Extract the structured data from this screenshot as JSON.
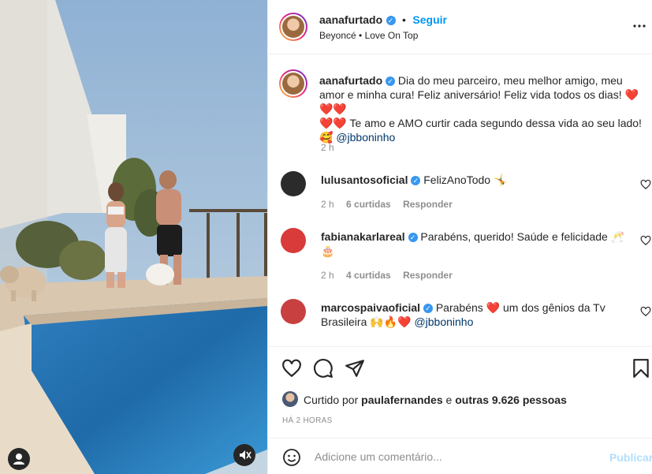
{
  "post": {
    "username": "aanafurtado",
    "follow_separator": "•",
    "follow_label": "Seguir",
    "audio": "Beyoncé • Love On Top",
    "caption_part1": "Dia do meu parceiro, meu melhor amigo, meu amor e minha cura! Feliz aniversário! Feliz vida todos os dias! ",
    "caption_hearts1": "❤️❤️❤️",
    "caption_hearts2": "❤️❤️",
    "caption_part2": " Te amo e AMO curtir cada segundo dessa vida ao seu lado!",
    "caption_emoji": "🥰",
    "caption_mention": "@jbboninho",
    "caption_time": "2 h"
  },
  "comments": [
    {
      "username": "lulusantosoficial",
      "text": "FelizAnoTodo",
      "emoji": "🤸",
      "time": "2 h",
      "likes": "6 curtidas",
      "reply": "Responder",
      "avatar_color": "#2b2b2b"
    },
    {
      "username": "fabianakarlareal",
      "text": "Parabéns, querido! Saúde e felicidade",
      "emoji": "🥂",
      "emoji2": "🎂",
      "time": "2 h",
      "likes": "4 curtidas",
      "reply": "Responder",
      "avatar_color": "#d93a3a"
    },
    {
      "username": "marcospaivaoficial",
      "text_part1": "Parabéns ",
      "heart": "❤️",
      "text_part2": " um dos gênios da Tv Brasileira ",
      "emojis": "🙌🔥❤️",
      "mention": "@jbboninho",
      "avatar_color": "#c94040"
    }
  ],
  "likes_line": {
    "prefix": "Curtido por ",
    "user": "paulafernandes",
    "middle": " e ",
    "others": "outras 9.626 pessoas"
  },
  "time_ago": "HÁ 2 HORAS",
  "add_comment": {
    "placeholder": "Adicione um comentário...",
    "publish_label": "Publicar"
  },
  "icons": {
    "more": "more-options-icon",
    "like": "heart-icon",
    "comment": "comment-icon",
    "share": "share-icon",
    "save": "bookmark-icon",
    "emoji": "emoji-icon",
    "mute": "muted-speaker-icon",
    "tag": "user-tag-icon"
  },
  "colors": {
    "accent": "#0095f6",
    "verified": "#3897f0",
    "secondary_text": "#8e8e8e",
    "heart_red": "#ed4956"
  }
}
